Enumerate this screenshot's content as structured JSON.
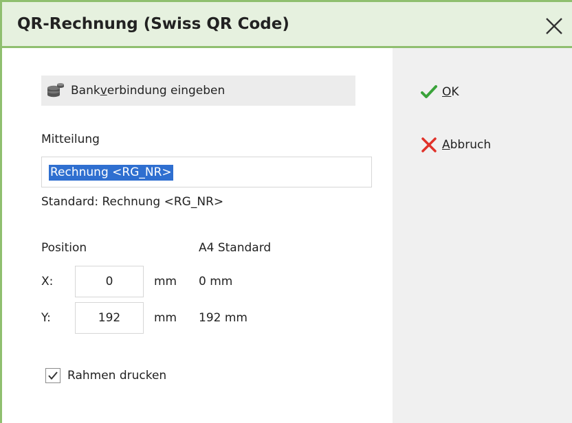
{
  "dialog": {
    "title": "QR-Rechnung (Swiss QR Code)",
    "close_icon": "close-icon"
  },
  "bank_button": {
    "label_pre": "Bank",
    "label_mnemonic": "v",
    "label_post": "erbindung eingeben",
    "icon": "coins-icon"
  },
  "message": {
    "label": "Mitteilung",
    "value": "Rechnung <RG_NR>",
    "default_text": "Standard: Rechnung <RG_NR>"
  },
  "position": {
    "label": "Position",
    "standard_header": "A4 Standard",
    "x": {
      "label": "X:",
      "value": "0",
      "unit": "mm",
      "standard": "0 mm"
    },
    "y": {
      "label": "Y:",
      "value": "192",
      "unit": "mm",
      "standard": "192 mm"
    }
  },
  "frame_checkbox": {
    "label": "Rahmen drucken",
    "checked": true
  },
  "actions": {
    "ok": {
      "mnemonic": "O",
      "rest": "K",
      "icon": "checkmark-icon",
      "color": "#3aa33a"
    },
    "cancel": {
      "mnemonic": "A",
      "rest": "bbruch",
      "icon": "cross-icon",
      "color": "#e0322a"
    }
  },
  "colors": {
    "title_bg": "#e6f1df",
    "accent_border": "#8fbf6f",
    "side_panel": "#f0f0f0",
    "selection": "#2f6fd0"
  }
}
